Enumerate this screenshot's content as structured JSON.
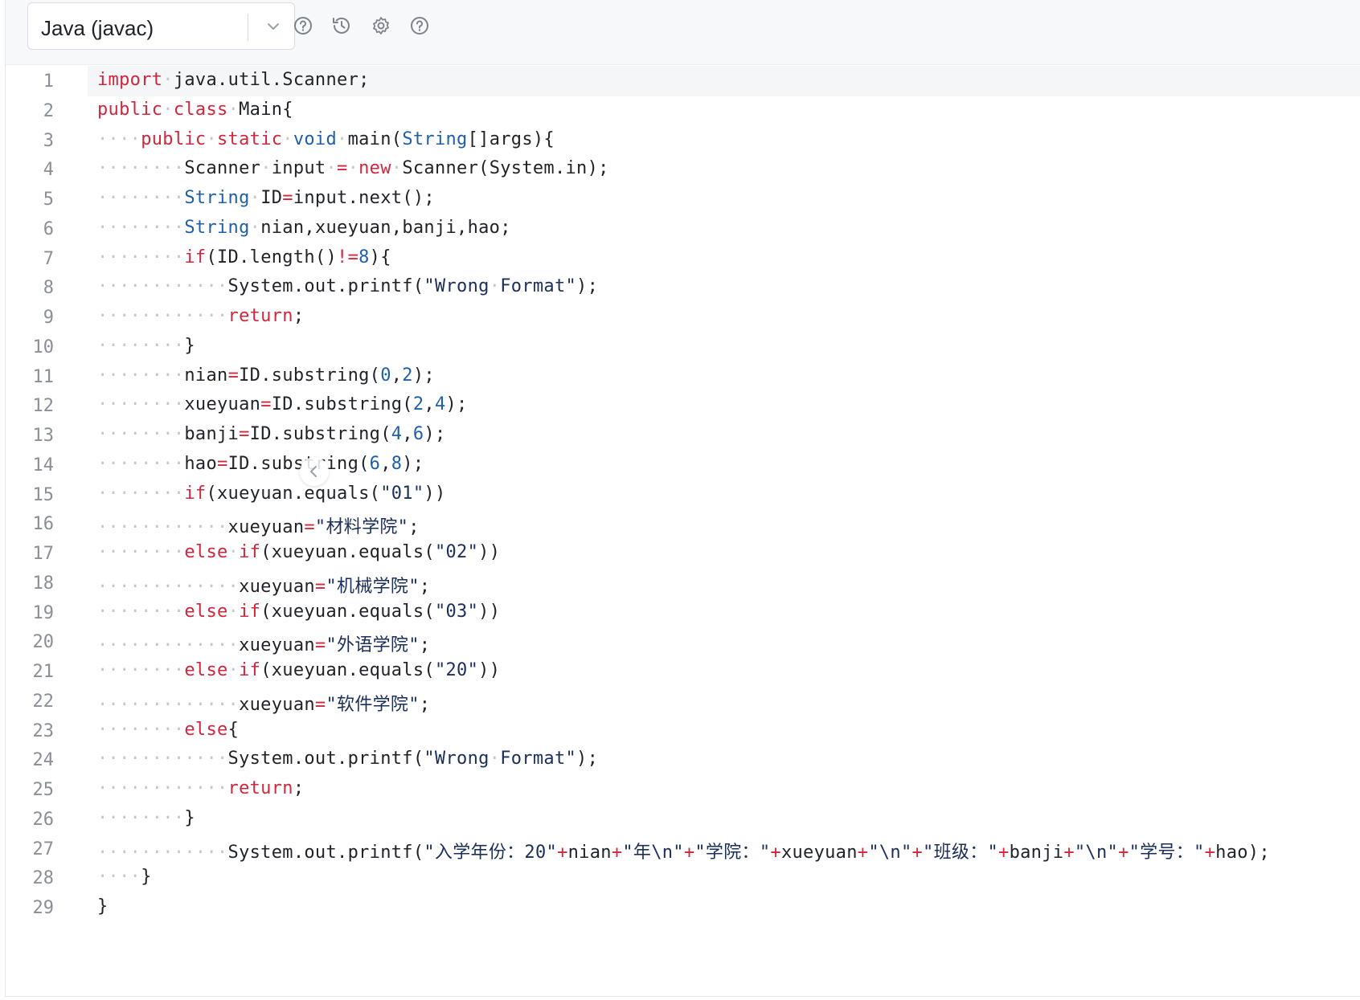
{
  "toolbar": {
    "language": "Java (javac)",
    "icons": [
      "help-circle-icon",
      "history-icon",
      "settings-gear-icon",
      "question-icon"
    ]
  },
  "editor": {
    "active_line": 1,
    "lines": [
      {
        "n": "1",
        "code": "import·java.util.Scanner;"
      },
      {
        "n": "2",
        "code": "public·class·Main{"
      },
      {
        "n": "3",
        "code": "····public·static·void·main(String[]args){"
      },
      {
        "n": "4",
        "code": "········Scanner·input·=·new·Scanner(System.in);"
      },
      {
        "n": "5",
        "code": "········String·ID=input.next();"
      },
      {
        "n": "6",
        "code": "········String·nian,xueyuan,banji,hao;"
      },
      {
        "n": "7",
        "code": "········if(ID.length()!=8){"
      },
      {
        "n": "8",
        "code": "············System.out.printf(\"Wrong·Format\");"
      },
      {
        "n": "9",
        "code": "············return;"
      },
      {
        "n": "10",
        "code": "········}"
      },
      {
        "n": "11",
        "code": "········nian=ID.substring(0,2);"
      },
      {
        "n": "12",
        "code": "········xueyuan=ID.substring(2,4);"
      },
      {
        "n": "13",
        "code": "········banji=ID.substring(4,6);"
      },
      {
        "n": "14",
        "code": "········hao=ID.substring(6,8);"
      },
      {
        "n": "15",
        "code": "········if(xueyuan.equals(\"01\"))"
      },
      {
        "n": "16",
        "code": "············xueyuan=\"材料学院\";"
      },
      {
        "n": "17",
        "code": "········else·if(xueyuan.equals(\"02\"))"
      },
      {
        "n": "18",
        "code": "·············xueyuan=\"机械学院\";"
      },
      {
        "n": "19",
        "code": "········else·if(xueyuan.equals(\"03\"))"
      },
      {
        "n": "20",
        "code": "·············xueyuan=\"外语学院\";"
      },
      {
        "n": "21",
        "code": "········else·if(xueyuan.equals(\"20\"))"
      },
      {
        "n": "22",
        "code": "·············xueyuan=\"软件学院\";"
      },
      {
        "n": "23",
        "code": "········else{"
      },
      {
        "n": "24",
        "code": "············System.out.printf(\"Wrong·Format\");"
      },
      {
        "n": "25",
        "code": "············return;"
      },
      {
        "n": "26",
        "code": "········}"
      },
      {
        "n": "27",
        "code": "············System.out.printf(\"入学年份：20\"+nian+\"年\\n\"+\"学院：\"+xueyuan+\"\\n\"+\"班级：\"+banji+\"\\n\"+\"学号：\"+hao);"
      },
      {
        "n": "28",
        "code": "····}"
      },
      {
        "n": "29",
        "code": "}"
      }
    ]
  },
  "colors": {
    "keyword": "#d1263c",
    "type": "#1f5fa8",
    "number": "#1f5fa8",
    "string": "#1b2f5a",
    "whitespace_marker": "#c4c7cc",
    "line_number": "#8a8f98",
    "active_line_bg": "#f5f6f8",
    "toolbar_bg": "#f7f8fa"
  }
}
